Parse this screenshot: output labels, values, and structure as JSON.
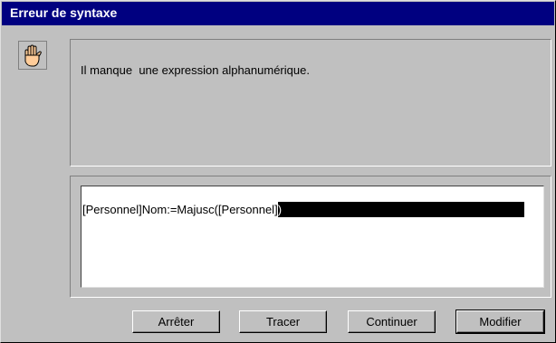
{
  "dialog": {
    "title": "Erreur de syntaxe",
    "icon": "stop-hand-icon",
    "message": "Il manque  une expression alphanumérique.",
    "code": {
      "text_before_selection": "[Personnel]Nom:=Majusc([Personnel]",
      "selected_text": ")"
    },
    "buttons": {
      "stop": "Arrêter",
      "trace": "Tracer",
      "continue": "Continuer",
      "modify": "Modifier"
    }
  },
  "colors": {
    "titlebar": "#000080",
    "face": "#c0c0c0",
    "selection": "#000000"
  }
}
